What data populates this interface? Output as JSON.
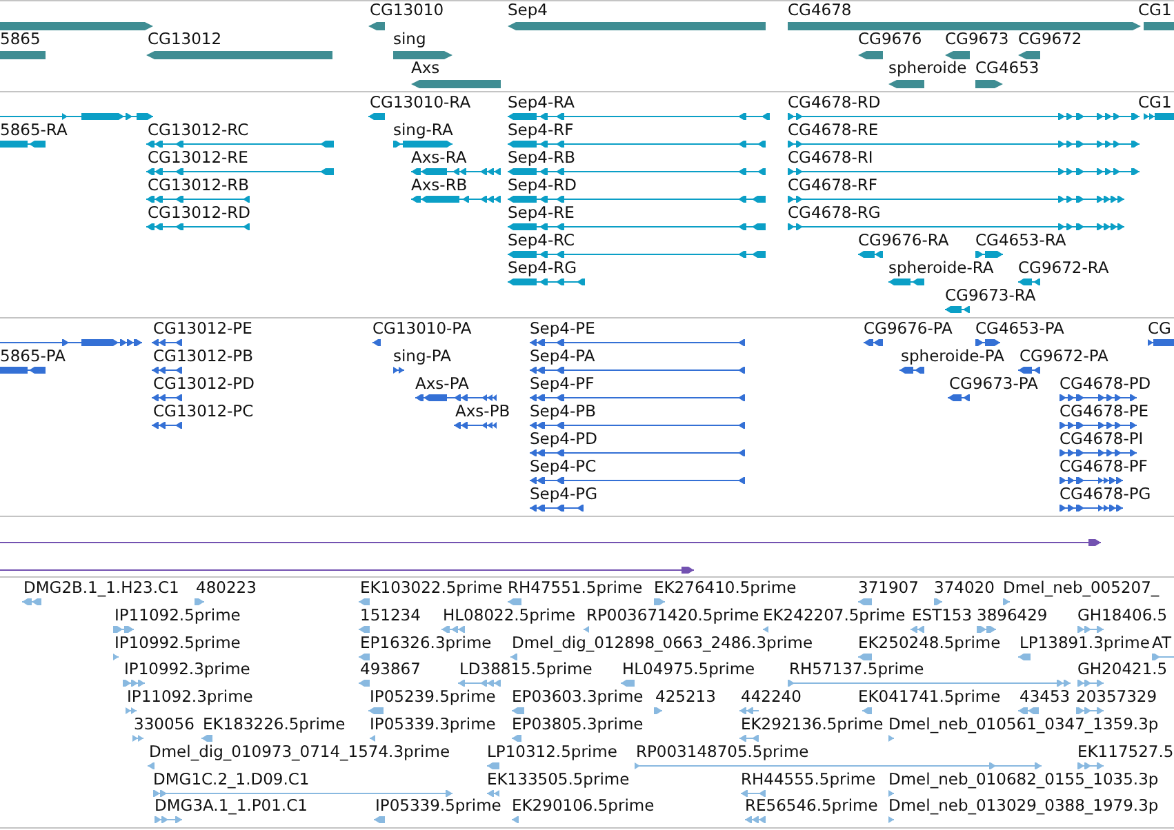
{
  "tracks": [
    {
      "kind": "gene",
      "features": [
        {
          "reverse": false
        },
        {
          "label": "CG13010",
          "reverse": true
        },
        {
          "label": "Sep4",
          "reverse": true
        },
        {
          "label": "CG4678",
          "reverse": false
        },
        {
          "label": "CG1",
          "reverse": false
        },
        {
          "label": "5865",
          "reverse": true
        },
        {
          "label": "CG13012",
          "reverse": true
        },
        {
          "label": "sing",
          "reverse": false
        },
        {
          "label": "CG9676",
          "reverse": true
        },
        {
          "label": "CG9673",
          "reverse": true
        },
        {
          "label": "CG9672",
          "reverse": true
        },
        {
          "label": "Axs",
          "reverse": true
        },
        {
          "label": "spheroide",
          "reverse": true
        },
        {
          "label": "CG4653",
          "reverse": false
        }
      ]
    },
    {
      "kind": "transcript",
      "features": [
        {
          "reverse": false
        },
        {
          "label": "CG13010-RA",
          "reverse": true
        },
        {
          "label": "Sep4-RA",
          "reverse": true
        },
        {
          "label": "CG4678-RD",
          "reverse": false
        },
        {
          "label": "CG1",
          "reverse": false
        },
        {
          "label": "5865-RA",
          "reverse": true
        },
        {
          "label": "CG13012-RC",
          "reverse": true
        },
        {
          "label": "sing-RA",
          "reverse": false
        },
        {
          "label": "Sep4-RF",
          "reverse": true
        },
        {
          "label": "CG4678-RE",
          "reverse": false
        },
        {
          "label": "CG13012-RE",
          "reverse": true
        },
        {
          "label": "Axs-RA",
          "reverse": true
        },
        {
          "label": "Sep4-RB",
          "reverse": true
        },
        {
          "label": "CG4678-RI",
          "reverse": false
        },
        {
          "label": "CG13012-RB",
          "reverse": true
        },
        {
          "label": "Axs-RB",
          "reverse": true
        },
        {
          "label": "Sep4-RD",
          "reverse": true
        },
        {
          "label": "CG4678-RF",
          "reverse": false
        },
        {
          "label": "CG13012-RD",
          "reverse": true
        },
        {
          "label": "Sep4-RE",
          "reverse": true
        },
        {
          "label": "CG4678-RG",
          "reverse": false
        },
        {
          "label": "Sep4-RC",
          "reverse": true
        },
        {
          "label": "CG9676-RA",
          "reverse": true
        },
        {
          "label": "CG4653-RA",
          "reverse": false
        },
        {
          "label": "Sep4-RG",
          "reverse": true
        },
        {
          "label": "spheroide-RA",
          "reverse": true
        },
        {
          "label": "CG9672-RA",
          "reverse": true
        },
        {
          "label": "CG9673-RA",
          "reverse": true
        }
      ]
    },
    {
      "kind": "protein",
      "features": [
        {
          "reverse": false
        },
        {
          "label": "CG13012-PE",
          "reverse": true
        },
        {
          "label": "CG13010-PA",
          "reverse": true
        },
        {
          "label": "Sep4-PE",
          "reverse": true
        },
        {
          "label": "CG9676-PA",
          "reverse": true
        },
        {
          "label": "CG4653-PA",
          "reverse": false
        },
        {
          "label": "CG",
          "reverse": false
        },
        {
          "label": "5865-PA",
          "reverse": true
        },
        {
          "label": "CG13012-PB",
          "reverse": true
        },
        {
          "label": "sing-PA",
          "reverse": false
        },
        {
          "label": "Sep4-PA",
          "reverse": true
        },
        {
          "label": "spheroide-PA",
          "reverse": true
        },
        {
          "label": "CG9672-PA",
          "reverse": true
        },
        {
          "label": "CG13012-PD",
          "reverse": true
        },
        {
          "label": "Axs-PA",
          "reverse": true
        },
        {
          "label": "Sep4-PF",
          "reverse": true
        },
        {
          "label": "CG9673-PA",
          "reverse": true
        },
        {
          "label": "CG4678-PD",
          "reverse": false
        },
        {
          "label": "CG13012-PC",
          "reverse": true
        },
        {
          "label": "Axs-PB",
          "reverse": true
        },
        {
          "label": "Sep4-PB",
          "reverse": true
        },
        {
          "label": "CG4678-PE",
          "reverse": false
        },
        {
          "label": "Sep4-PD",
          "reverse": true
        },
        {
          "label": "CG4678-PI",
          "reverse": false
        },
        {
          "label": "Sep4-PC",
          "reverse": true
        },
        {
          "label": "CG4678-PF",
          "reverse": false
        },
        {
          "label": "Sep4-PG",
          "reverse": true
        },
        {
          "label": "CG4678-PG",
          "reverse": false
        }
      ]
    },
    {
      "kind": "alignment",
      "features": [
        {
          "reverse": false
        },
        {
          "reverse": false
        }
      ]
    },
    {
      "kind": "est",
      "features": [
        {
          "label": "DMG2B.1_1.H23.C1",
          "reverse": true
        },
        {
          "label": "480223",
          "reverse": false
        },
        {
          "label": "EK103022.5prime",
          "reverse": true
        },
        {
          "label": "RH47551.5prime",
          "reverse": true
        },
        {
          "label": "EK276410.5prime",
          "reverse": false
        },
        {
          "label": "371907",
          "reverse": true
        },
        {
          "label": "374020",
          "reverse": false
        },
        {
          "label": "Dmel_neb_005207_",
          "reverse": false
        },
        {
          "label": "IP11092.5prime",
          "reverse": false
        },
        {
          "label": "151234",
          "reverse": true
        },
        {
          "label": "HL08022.5prime",
          "reverse": true
        },
        {
          "label": "RP003671420.5prime",
          "reverse": true
        },
        {
          "label": "EK242207.5prime",
          "reverse": true
        },
        {
          "label": "EST153",
          "reverse": true
        },
        {
          "label": "3896429",
          "reverse": false
        },
        {
          "label": "GH18406.5",
          "reverse": false
        },
        {
          "label": "IP10992.5prime",
          "reverse": false
        },
        {
          "label": "EP16326.3prime",
          "reverse": true
        },
        {
          "label": "Dmel_dig_012898_0663_2486.3prime",
          "reverse": true
        },
        {
          "label": "EK250248.5prime",
          "reverse": true
        },
        {
          "label": "LP13891.3prime",
          "reverse": true
        },
        {
          "label": "AT",
          "reverse": false
        },
        {
          "label": "IP10992.3prime",
          "reverse": false
        },
        {
          "label": "493867",
          "reverse": true
        },
        {
          "label": "LD38815.5prime",
          "reverse": true
        },
        {
          "label": "HL04975.5prime",
          "reverse": true
        },
        {
          "label": "RH57137.5prime",
          "reverse": false
        },
        {
          "label": "GH20421.5",
          "reverse": false
        },
        {
          "label": "IP11092.3prime",
          "reverse": false
        },
        {
          "label": "IP05239.5prime",
          "reverse": true
        },
        {
          "label": "EP03603.3prime",
          "reverse": true
        },
        {
          "label": "425213",
          "reverse": false
        },
        {
          "label": "442240",
          "reverse": true
        },
        {
          "label": "EK041741.5prime",
          "reverse": true
        },
        {
          "label": "43453",
          "reverse": true
        },
        {
          "label": "20357329",
          "reverse": false
        },
        {
          "label": "330056",
          "reverse": false
        },
        {
          "label": "EK183226.5prime",
          "reverse": true
        },
        {
          "label": "IP05339.3prime",
          "reverse": true
        },
        {
          "label": "EP03805.3prime",
          "reverse": true
        },
        {
          "label": "EK292136.5prime",
          "reverse": true
        },
        {
          "label": "Dmel_neb_010561_0347_1359.3p",
          "reverse": false
        },
        {
          "label": "Dmel_dig_010973_0714_1574.3prime",
          "reverse": true
        },
        {
          "label": "LP10312.5prime",
          "reverse": true
        },
        {
          "label": "RP003148705.5prime",
          "reverse": false
        },
        {
          "label": "EK117527.5",
          "reverse": false
        },
        {
          "label": "DMG1C.2_1.D09.C1",
          "reverse": false
        },
        {
          "label": "EK133505.5prime",
          "reverse": true
        },
        {
          "label": "RH44555.5prime",
          "reverse": true
        },
        {
          "label": "Dmel_neb_010682_0155_1035.3p",
          "reverse": false
        },
        {
          "label": "DMG3A.1_1.P01.C1",
          "reverse": false
        },
        {
          "label": "IP05339.5prime",
          "reverse": true
        },
        {
          "label": "EK290106.5prime",
          "reverse": true
        },
        {
          "label": "RE56546.5prime",
          "reverse": true
        },
        {
          "label": "Dmel_neb_013029_0388_1979.3p",
          "reverse": false
        }
      ]
    }
  ]
}
